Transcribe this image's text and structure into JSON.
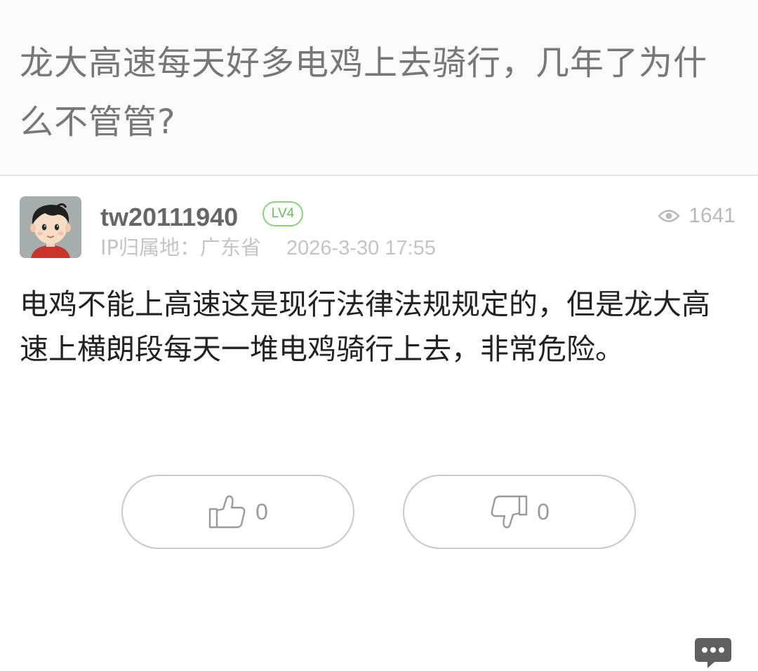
{
  "post": {
    "title": "龙大高速每天好多电鸡上去骑行，几年了为什么不管管?"
  },
  "comment": {
    "username": "tw20111940",
    "level": "LV4",
    "ip_location": "IP归属地：广东省",
    "timestamp": "2026-3-30 17:55",
    "views": "1641",
    "content": "电鸡不能上高速这是现行法律法规规定的，但是龙大高速上横朗段每天一堆电鸡骑行上去，非常危险。"
  },
  "actions": {
    "like_count": "0",
    "dislike_count": "0"
  },
  "icons": {
    "views": "eye-icon",
    "like": "thumbs-up-icon",
    "dislike": "thumbs-down-icon",
    "comment": "comment-bubble-icon"
  },
  "colors": {
    "level_badge": "#6bbd5b",
    "title_text": "#777777",
    "meta_text": "#c4c4c4"
  }
}
